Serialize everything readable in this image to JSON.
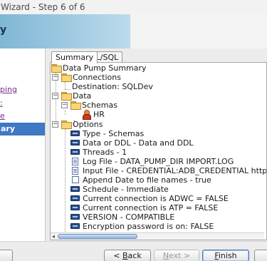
{
  "window": {
    "title": "Wizard - Step 6 of 6"
  },
  "banner": {
    "step_title": "y"
  },
  "left_nav": {
    "items": [
      {
        "label": "ping",
        "state": "link"
      },
      {
        "label": ":",
        "state": "link"
      },
      {
        "label": "e",
        "state": "link"
      },
      {
        "label": "ary",
        "state": "active"
      }
    ]
  },
  "tabs": [
    {
      "label": "Summary",
      "active": true
    },
    {
      "label": "PL/SQL",
      "active": false
    }
  ],
  "tree": {
    "root": "Data Pump Summary",
    "connections": {
      "label": "Connections",
      "destination": "Destination: SQLDev"
    },
    "data": {
      "label": "Data",
      "schemas_label": "Schemas",
      "schema_user": "HR"
    },
    "options": {
      "label": "Options",
      "items": [
        {
          "text": "Type - Schemas",
          "icon": "param-icon"
        },
        {
          "text": "Data or DDL - Data and DDL",
          "icon": "param-icon"
        },
        {
          "text": "Threads - 1",
          "icon": "param-icon"
        },
        {
          "text": "Log File - DATA_PUMP_DIR IMPORT.LOG",
          "icon": "doc-icon"
        },
        {
          "text": "Input File - CREDENTIAL:ADB_CREDENTIAL https://objectstorage.eu",
          "icon": "doc-icon"
        },
        {
          "text": "Append Date to file names - true",
          "icon": "check-icon"
        },
        {
          "text": "Schedule - Immediate",
          "icon": "param-icon"
        },
        {
          "text": "Current connection is ADWC = FALSE",
          "icon": "param-icon"
        },
        {
          "text": "Current connection is ATP = FALSE",
          "icon": "param-icon"
        },
        {
          "text": "VERSION - COMPATIBLE",
          "icon": "param-icon"
        },
        {
          "text": "Encryption password is on: FALSE",
          "icon": "param-icon"
        }
      ]
    }
  },
  "buttons": {
    "back": {
      "label": "< Back",
      "mnemonic": "B",
      "prefix": "< ",
      "rest": "ack",
      "enabled": true
    },
    "next": {
      "label": "Next >",
      "mnemonic": "N",
      "rest": "ext >",
      "enabled": false
    },
    "finish": {
      "label": "Finish",
      "mnemonic": "F",
      "rest": "inish",
      "enabled": true
    }
  },
  "colors": {
    "nav_active": "#3f78c4",
    "link": "#7a2a8c",
    "folder": "#f7d57a",
    "param_icon": "#2a4e8a"
  }
}
